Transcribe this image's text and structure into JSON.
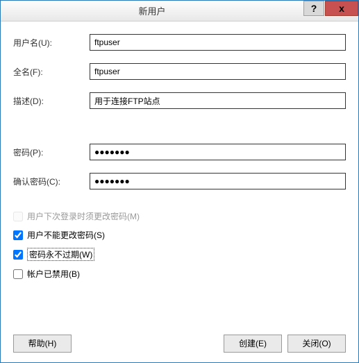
{
  "titlebar": {
    "title": "新用户",
    "help": "?",
    "close": "x"
  },
  "fields": {
    "username_label": "用户名(U):",
    "username_value": "ftpuser",
    "fullname_label": "全名(F):",
    "fullname_value": "ftpuser",
    "description_label": "描述(D):",
    "description_value": "用于连接FTP站点",
    "password_label": "密码(P):",
    "password_value": "●●●●●●●",
    "confirm_label": "确认密码(C):",
    "confirm_value": "●●●●●●●"
  },
  "checkboxes": {
    "must_change_label": "用户下次登录时须更改密码(M)",
    "must_change_checked": false,
    "must_change_disabled": true,
    "cannot_change_label": "用户不能更改密码(S)",
    "cannot_change_checked": true,
    "never_expires_label": "密码永不过期(W)",
    "never_expires_checked": true,
    "disabled_account_label": "帐户已禁用(B)",
    "disabled_account_checked": false
  },
  "buttons": {
    "help": "帮助(H)",
    "create": "创建(E)",
    "close": "关闭(O)"
  }
}
